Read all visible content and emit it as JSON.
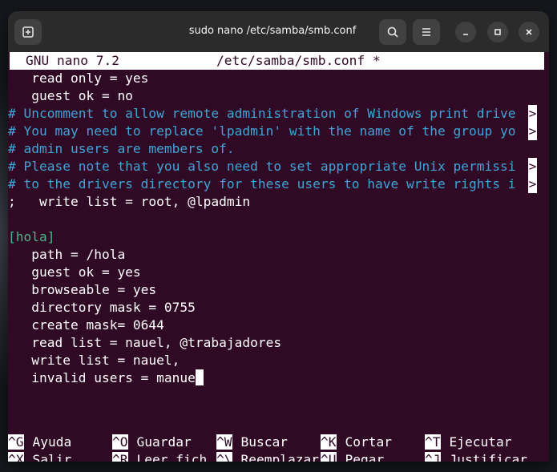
{
  "window": {
    "title": "sudo nano /etc/samba/smb.conf"
  },
  "icons": {
    "new_tab": "new-tab-icon",
    "search": "search-icon",
    "menu": "hamburger-menu-icon",
    "minimize": "minimize-icon",
    "maximize": "maximize-icon",
    "close": "close-icon"
  },
  "nano": {
    "version": "GNU nano 7.2",
    "filename": "/etc/samba/smb.conf *",
    "lines": [
      {
        "text": "   read only = yes",
        "kind": "normal",
        "overflow": false
      },
      {
        "text": "   guest ok = no",
        "kind": "normal",
        "overflow": false
      },
      {
        "text": "# Uncomment to allow remote administration of Windows print drive",
        "kind": "comment",
        "overflow": true
      },
      {
        "text": "# You may need to replace 'lpadmin' with the name of the group yo",
        "kind": "comment",
        "overflow": true
      },
      {
        "text": "# admin users are members of.",
        "kind": "comment",
        "overflow": false
      },
      {
        "text": "# Please note that you also need to set appropriate Unix permissi",
        "kind": "comment",
        "overflow": true
      },
      {
        "text": "# to the drivers directory for these users to have write rights i",
        "kind": "comment",
        "overflow": true
      },
      {
        "text": ";   write list = root, @lpadmin",
        "kind": "normal",
        "overflow": false
      },
      {
        "text": "",
        "kind": "normal",
        "overflow": false
      },
      {
        "text": "[hola]",
        "kind": "section",
        "overflow": false
      },
      {
        "text": "   path = /hola",
        "kind": "normal",
        "overflow": false
      },
      {
        "text": "   guest ok = yes",
        "kind": "normal",
        "overflow": false
      },
      {
        "text": "   browseable = yes",
        "kind": "normal",
        "overflow": false
      },
      {
        "text": "   directory mask = 0755",
        "kind": "normal",
        "overflow": false
      },
      {
        "text": "   create mask= 0644",
        "kind": "normal",
        "overflow": false
      },
      {
        "text": "   read list = nauel, @trabajadores",
        "kind": "normal",
        "overflow": false
      },
      {
        "text": "   write list = nauel,",
        "kind": "normal",
        "overflow": false
      },
      {
        "text": "   invalid users = manue",
        "kind": "cursor",
        "overflow": false
      }
    ],
    "overflow_char": ">",
    "help_row1": [
      {
        "key": "^G",
        "label": "Ayuda"
      },
      {
        "key": "^O",
        "label": "Guardar"
      },
      {
        "key": "^W",
        "label": "Buscar"
      },
      {
        "key": "^K",
        "label": "Cortar"
      },
      {
        "key": "^T",
        "label": "Ejecutar"
      }
    ],
    "help_row2": [
      {
        "key": "^X",
        "label": "Salir"
      },
      {
        "key": "^R",
        "label": "Leer fich."
      },
      {
        "key": "^\\",
        "label": "Reemplazar"
      },
      {
        "key": "^U",
        "label": "Pegar"
      },
      {
        "key": "^J",
        "label": "Justificar"
      }
    ]
  }
}
